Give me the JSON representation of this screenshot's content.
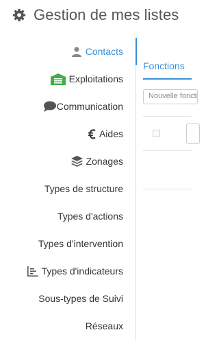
{
  "header": {
    "title": "Gestion de mes listes",
    "icon": "gear-icon"
  },
  "sidebar": {
    "items": [
      {
        "label": "Contacts",
        "icon": "user-icon"
      },
      {
        "label": "Exploitations",
        "icon": "barn-icon"
      },
      {
        "label": "Communication",
        "icon": "speech-bubble-icon"
      },
      {
        "label": "Aides",
        "icon": "euro-icon"
      },
      {
        "label": "Zonages",
        "icon": "layers-icon"
      },
      {
        "label": "Types de structure"
      },
      {
        "label": "Types d'actions"
      },
      {
        "label": "Types d'intervention"
      },
      {
        "label": "Types d'indicateurs",
        "icon": "chart-icon"
      },
      {
        "label": "Sous-types de Suivi"
      },
      {
        "label": "Réseaux"
      }
    ]
  },
  "main": {
    "tab": "Fonctions",
    "new_input_placeholder": "Nouvelle fonction"
  },
  "colors": {
    "accent": "#3a8fd6",
    "green": "#3fae49",
    "text": "#333333"
  }
}
